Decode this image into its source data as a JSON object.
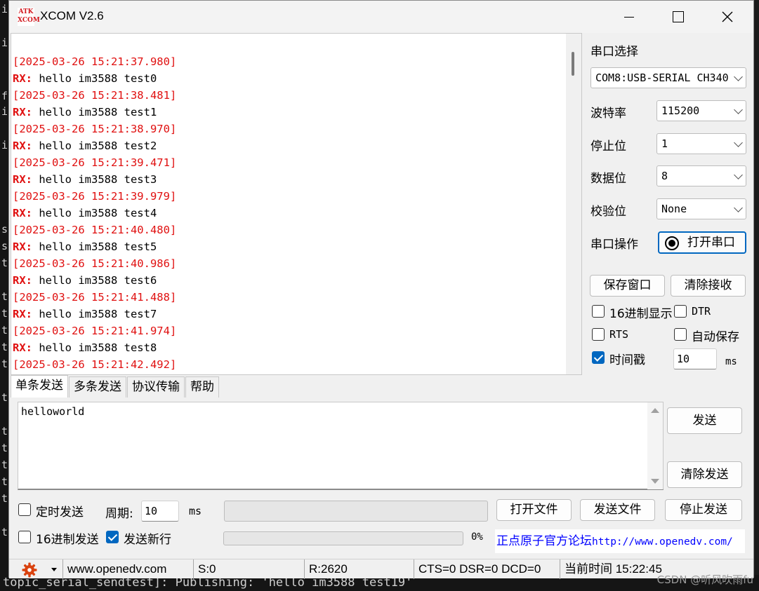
{
  "background": {
    "terminal_chars": [
      "i",
      "i",
      "f",
      "i",
      "i",
      "s",
      "s",
      "t",
      "t",
      "t",
      "t",
      "t",
      "t",
      "t",
      "t",
      "t",
      "t",
      "t",
      "t",
      "t"
    ],
    "bottom_line": "topic_serial_sendtest]: Publishing: 'hello im3588 test19'",
    "watermark": "CSDN @听风吹雨fu"
  },
  "window": {
    "logo_top": "ATK",
    "logo_bottom": "XCOM",
    "title": "XCOM V2.6"
  },
  "receive": {
    "lines": [
      {
        "ts": "[2025-03-26 15:21:37.980]",
        "tag": "RX:",
        "text": " hello im3588 test0"
      },
      {
        "ts": "[2025-03-26 15:21:38.481]",
        "tag": "RX:",
        "text": " hello im3588 test1"
      },
      {
        "ts": "[2025-03-26 15:21:38.970]",
        "tag": "RX:",
        "text": " hello im3588 test2"
      },
      {
        "ts": "[2025-03-26 15:21:39.471]",
        "tag": "RX:",
        "text": " hello im3588 test3"
      },
      {
        "ts": "[2025-03-26 15:21:39.979]",
        "tag": "RX:",
        "text": " hello im3588 test4"
      },
      {
        "ts": "[2025-03-26 15:21:40.480]",
        "tag": "RX:",
        "text": " hello im3588 test5"
      },
      {
        "ts": "[2025-03-26 15:21:40.986]",
        "tag": "RX:",
        "text": " hello im3588 test6"
      },
      {
        "ts": "[2025-03-26 15:21:41.488]",
        "tag": "RX:",
        "text": " hello im3588 test7"
      },
      {
        "ts": "[2025-03-26 15:21:41.974]",
        "tag": "RX:",
        "text": " hello im3588 test8"
      },
      {
        "ts": "[2025-03-26 15:21:42.492]",
        "tag": "",
        "text": ""
      }
    ]
  },
  "settings": {
    "port_label": "串口选择",
    "port_value": "COM8:USB-SERIAL CH340",
    "baud_label": "波特率",
    "baud_value": "115200",
    "stop_label": "停止位",
    "stop_value": "1",
    "data_label": "数据位",
    "data_value": "8",
    "parity_label": "校验位",
    "parity_value": "None",
    "op_label": "串口操作",
    "open_button": "打开串口",
    "save_window_button": "保存窗口",
    "clear_recv_button": "清除接收",
    "hex_display_label": "16进制显示",
    "dtr_label": "DTR",
    "rts_label": "RTS",
    "auto_save_label": "自动保存",
    "timestamp_label": "时间戳",
    "timestamp_value": "10",
    "timestamp_unit": "ms",
    "hex_display_checked": false,
    "dtr_checked": false,
    "rts_checked": false,
    "auto_save_checked": false,
    "timestamp_checked": true
  },
  "tabs": [
    "单条发送",
    "多条发送",
    "协议传输",
    "帮助"
  ],
  "send": {
    "text": "helloworld",
    "send_button": "发送",
    "clear_send_button": "清除发送",
    "timed_send_label": "定时发送",
    "timed_send_checked": false,
    "period_label": "周期:",
    "period_value": "10",
    "period_unit": "ms",
    "open_file_button": "打开文件",
    "send_file_button": "发送文件",
    "stop_send_button": "停止发送",
    "hex_send_label": "16进制发送",
    "hex_send_checked": false,
    "newline_label": "发送新行",
    "newline_checked": true,
    "progress_text": "0%",
    "progress": 0,
    "link_cn": "正点原子官方论坛",
    "link_url": "http://www.openedv.com/"
  },
  "status": {
    "website": "www.openedv.com",
    "sent": "S:0",
    "received": "R:2620",
    "signals": "CTS=0 DSR=0 DCD=0",
    "time": "当前时间 15:22:45"
  },
  "colors": {
    "timestamp_red": "#e01010",
    "accent_blue": "#0067c0",
    "link_blue": "#0000ff"
  }
}
